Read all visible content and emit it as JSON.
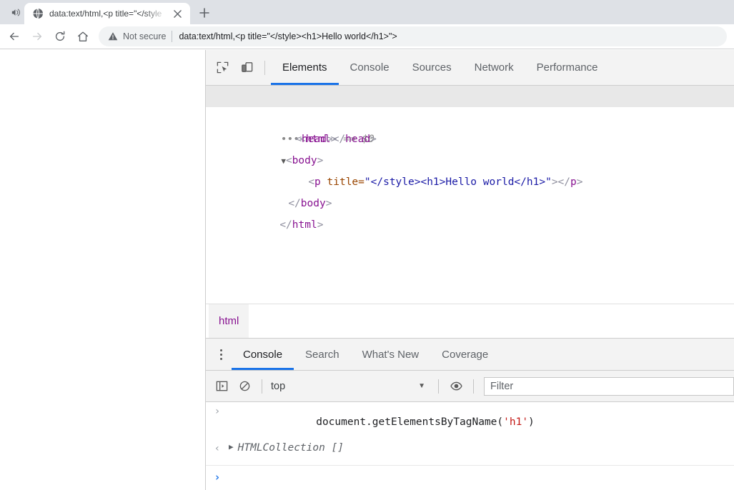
{
  "browser": {
    "tab": {
      "title": "data:text/html,<p title=\"</style",
      "audio_icon": "speaker-icon",
      "favicon": "globe-icon",
      "close_icon": "close-icon"
    },
    "new_tab_label": "+",
    "nav": {
      "back_icon": "back-arrow-icon",
      "forward_icon": "forward-arrow-icon",
      "reload_icon": "reload-icon",
      "home_icon": "home-icon"
    },
    "omnibox": {
      "security_icon": "warning-triangle-icon",
      "security_text": "Not secure",
      "url": "data:text/html,<p title=\"</style><h1>Hello world</h1>\">"
    }
  },
  "devtools": {
    "toolbar_icons": {
      "inspect": "inspect-element-icon",
      "device": "device-toolbar-icon"
    },
    "tabs": [
      {
        "label": "Elements",
        "active": true
      },
      {
        "label": "Console",
        "active": false
      },
      {
        "label": "Sources",
        "active": false
      },
      {
        "label": "Network",
        "active": false
      },
      {
        "label": "Performance",
        "active": false
      }
    ],
    "dom": {
      "row1": {
        "dots": "•••",
        "open": "<",
        "tag": "html",
        "close": ">",
        "eq": "==",
        "dollar": "$0"
      },
      "row2": {
        "open": "<",
        "tag": "head",
        "close": ">",
        "open2": "</",
        "tag2": "head",
        "close2": ">"
      },
      "row3": {
        "arrow": "▼",
        "open": "<",
        "tag": "body",
        "close": ">"
      },
      "row4": {
        "open": "<",
        "tag": "p",
        "attr": "title",
        "eq": "=",
        "value": "\"</style><h1>Hello world</h1>\"",
        "close": ">",
        "endopen": "</",
        "endtag": "p",
        "endclose": ">"
      },
      "row5": {
        "open": "</",
        "tag": "body",
        "close": ">"
      },
      "row6": {
        "open": "</",
        "tag": "html",
        "close": ">"
      }
    },
    "breadcrumb": [
      "html"
    ],
    "drawer": {
      "menu_icon": "kebab-menu-icon",
      "tabs": [
        {
          "label": "Console",
          "active": true
        },
        {
          "label": "Search",
          "active": false
        },
        {
          "label": "What's New",
          "active": false
        },
        {
          "label": "Coverage",
          "active": false
        }
      ],
      "console_toolbar": {
        "sidebar_icon": "console-sidebar-icon",
        "clear_icon": "clear-console-icon",
        "context_value": "top",
        "caret": "▼",
        "eye_icon": "live-expression-eye-icon",
        "filter_placeholder": "Filter"
      },
      "console_lines": [
        {
          "gutter": "›",
          "prefix": "document.getElementsByTagName(",
          "string": "'h1'",
          "suffix": ")"
        },
        {
          "gutter": "‹",
          "disclosure": "▶",
          "result": "HTMLCollection []"
        }
      ],
      "prompt_symbol": "›"
    }
  },
  "colors": {
    "accent": "#1a73e8",
    "tag": "#881391",
    "attr": "#994500",
    "value": "#1a1aa6",
    "string": "#c41a16"
  }
}
